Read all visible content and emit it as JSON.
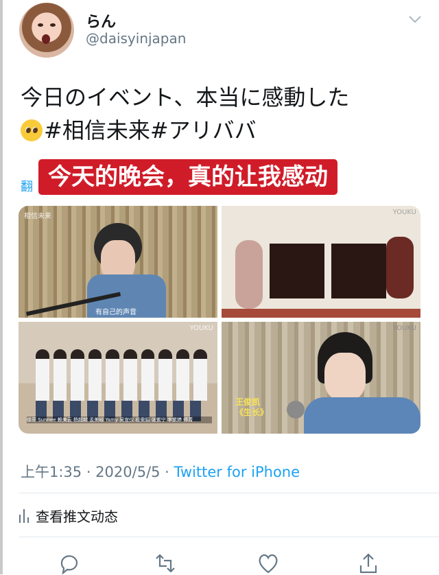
{
  "tweet": {
    "display_name": "らん",
    "handle": "@daisyinjapan",
    "text_line1": "今日のイベント、本当に感動した",
    "text_line2": "#相信未来#アリババ",
    "translate_label": "翻",
    "caption_overlay": "今天的晚会，真的让我感动",
    "timestamp": "上午1:35 · 2020/5/5 · ",
    "source": "Twitter for iPhone",
    "activity_label": "查看推文动态"
  },
  "media": {
    "tiles": [
      {
        "badge": "相信未来",
        "caption": "有自己的声音"
      },
      {
        "badge": "YOUKU",
        "caption": ""
      },
      {
        "badge": "YOUKU",
        "caption": "徐菲 Sunnee 赖美云 杨超越 孟美岐 Yamy 吴宣仪 段奥娟 张紫宁 李紫婷 傅菁"
      },
      {
        "badge": "YOUKU",
        "caption": "王俊凯 《生长》"
      }
    ]
  },
  "icons": [
    "chevron-down-icon",
    "reply-icon",
    "retweet-icon",
    "like-icon",
    "share-icon",
    "activity-chart-icon",
    "face-emoji-icon"
  ],
  "colors": {
    "accent": "#1da1f2",
    "banner": "#d01c29",
    "muted": "#657786"
  }
}
